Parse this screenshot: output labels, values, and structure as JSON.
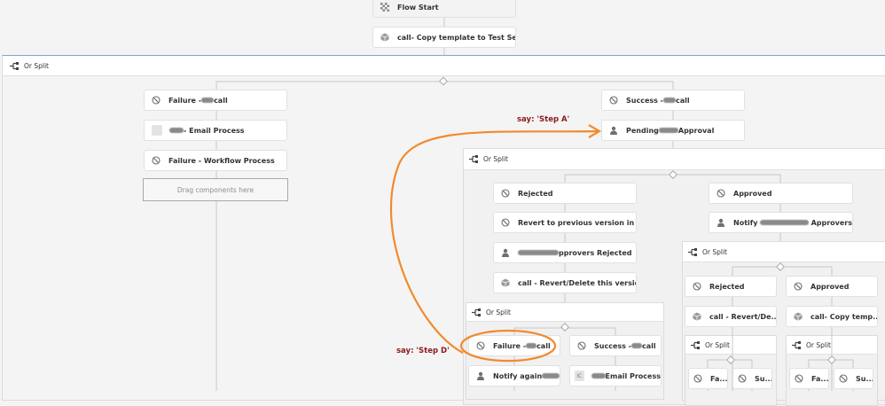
{
  "flow": {
    "start": "Flow Start",
    "copy_template": {
      "post": "call- Copy template to Test Servers"
    },
    "or_split": "Or Split",
    "left": {
      "failure_call": {
        "pre": "Failure - ",
        "post": "call"
      },
      "email_process": {
        "post": "- Email Process"
      },
      "failure_workflow": "Failure - Workflow Process",
      "drag_placeholder": "Drag components here"
    },
    "right": {
      "success_call": {
        "pre": "Success - ",
        "post": "call"
      },
      "pending_approval": {
        "pre": "Pending",
        "post": "Approval"
      },
      "split": {
        "rejected": "Rejected",
        "revert_previous": "Revert to previous version in AEM",
        "approvers_rejected": {
          "post": "pprovers Rejected"
        },
        "revert_delete": {
          "post": "call - Revert/Delete this version in..."
        },
        "approved": "Approved",
        "notify_approvers": {
          "pre": "Notify",
          "post": "Approvers"
        },
        "sub_split_left": {
          "failure_call": {
            "pre": "Failure - ",
            "post": "call"
          },
          "success_call": {
            "pre": "Success - ",
            "post": "call"
          },
          "notify_again": {
            "pre": "Notify again "
          },
          "email_badge": "IC",
          "email_process": {
            "post": "Email Process"
          }
        },
        "sub_split_right": {
          "rejected": "Rejected",
          "approved": "Approved",
          "revert_short": {
            "post": "call - Revert/De..."
          },
          "copy_short": {
            "post": "call- Copy temp..."
          },
          "fa": "Fa...",
          "su": "Su..."
        }
      }
    }
  },
  "annotations": {
    "step_a": "say: 'Step A'",
    "step_d": "say: 'Step D'",
    "color": "#f28a2e"
  }
}
